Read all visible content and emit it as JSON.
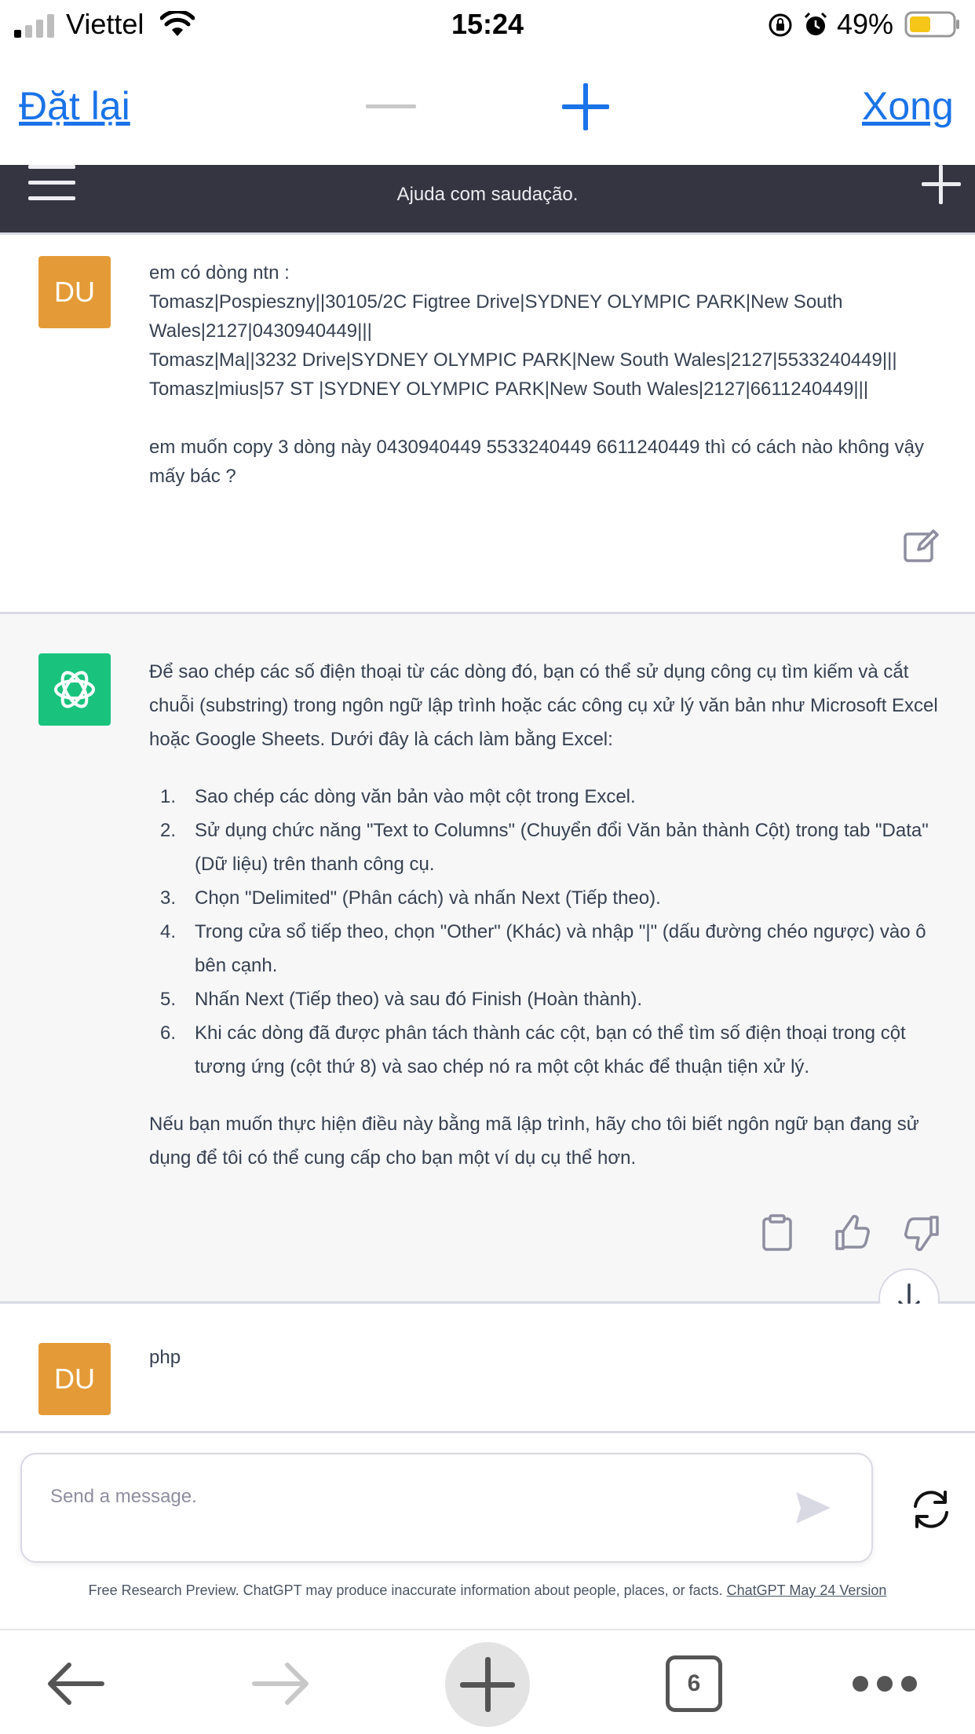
{
  "status_bar": {
    "carrier": "Viettel",
    "time": "15:24",
    "battery_percent": "49%"
  },
  "toolbar": {
    "reset_label": "Đặt lại",
    "done_label": "Xong"
  },
  "chat_header": {
    "title": "Ajuda com saudação."
  },
  "messages": {
    "user1": {
      "avatar": "DU",
      "lines": [
        "em có dòng ntn :",
        "Tomasz|Pospieszny||30105/2C Figtree Drive|SYDNEY OLYMPIC PARK|New South Wales|2127|0430940449|||",
        "Tomasz|Ma||3232 Drive|SYDNEY OLYMPIC PARK|New South Wales|2127|5533240449|||",
        "Tomasz|mius|57 ST |SYDNEY OLYMPIC PARK|New South Wales|2127|6611240449|||",
        "em muốn copy 3 dòng này 0430940449 5533240449 6611240449 thì có cách nào không vậy mấy bác ?"
      ]
    },
    "assistant": {
      "intro": "Để sao chép các số điện thoại từ các dòng đó, bạn có thể sử dụng công cụ tìm kiếm và cắt chuỗi (substring) trong ngôn ngữ lập trình hoặc các công cụ xử lý văn bản như Microsoft Excel hoặc Google Sheets. Dưới đây là cách làm bằng Excel:",
      "steps": [
        {
          "num": "1.",
          "text": "Sao chép các dòng văn bản vào một cột trong Excel."
        },
        {
          "num": "2.",
          "text": "Sử dụng chức năng \"Text to Columns\" (Chuyển đổi Văn bản thành Cột) trong tab \"Data\" (Dữ liệu) trên thanh công cụ."
        },
        {
          "num": "3.",
          "text": "Chọn \"Delimited\" (Phân cách) và nhấn Next (Tiếp theo)."
        },
        {
          "num": "4.",
          "text": "Trong cửa sổ tiếp theo, chọn \"Other\" (Khác) và nhập \"|\" (dấu đường chéo ngược) vào ô bên cạnh."
        },
        {
          "num": "5.",
          "text": "Nhấn Next (Tiếp theo) và sau đó Finish (Hoàn thành)."
        },
        {
          "num": "6.",
          "text": "Khi các dòng đã được phân tách thành các cột, bạn có thể tìm số điện thoại trong cột tương ứng (cột thứ 8) và sao chép nó ra một cột khác để thuận tiện xử lý."
        }
      ],
      "outro": "Nếu bạn muốn thực hiện điều này bằng mã lập trình, hãy cho tôi biết ngôn ngữ bạn đang sử dụng để tôi có thể cung cấp cho bạn một ví dụ cụ thể hơn."
    },
    "user2": {
      "avatar": "DU",
      "text": "php"
    }
  },
  "composer": {
    "placeholder": "Send a message."
  },
  "disclaimer": {
    "text": "Free Research Preview. ChatGPT may produce inaccurate information about people, places, or facts.",
    "link": "ChatGPT May 24 Version"
  },
  "browser_bar": {
    "tab_count": "6"
  },
  "colors": {
    "link_blue": "#1a73e8",
    "header_dark": "#343541",
    "user_avatar": "#e49b37",
    "gpt_avatar": "#19c37d"
  }
}
